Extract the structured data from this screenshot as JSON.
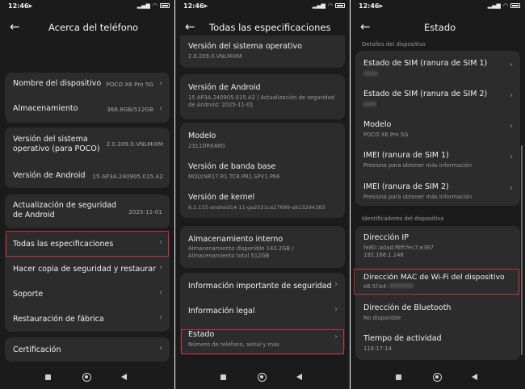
{
  "status": {
    "time": "12:46"
  },
  "screen1": {
    "title": "Acerca del teléfono",
    "device_name_label": "Nombre del dispositivo",
    "device_name_value": "POCO X6 Pro 5G",
    "storage_label": "Almacenamiento",
    "storage_value": "368.8GB/512GB",
    "os_version_label": "Versión del sistema operativo (para POCO)",
    "os_version_value": "2.0.209.0.VNLMIXM",
    "android_label": "Versión de Android",
    "android_value": "15 AP3A.240905.015.A2",
    "security_label": "Actualización de seguridad de Android",
    "security_value": "2025-11-01",
    "all_specs_label": "Todas las especificaciones",
    "backup_label": "Hacer copia de seguridad y restaurar",
    "support_label": "Soporte",
    "factory_label": "Restauración de fábrica",
    "cert_label": "Certificación"
  },
  "screen2": {
    "title": "Todas las especificaciones",
    "os_label": "Versión del sistema operativo",
    "os_value": "2.0.209.0.VNLMIXM",
    "android_label": "Versión de Android",
    "android_value": "15 AP3A.240905.015.A2 | Actualización de seguridad de Android: 2025-11-01",
    "model_label": "Modelo",
    "model_value": "2311DRK48G",
    "baseband_label": "Versión de banda base",
    "baseband_value": "MOLY.NR17.R1.TC8.PR1.SPV1.P66",
    "kernel_label": "Versión de kernel",
    "kernel_value": "6.1.115-android14-11-ga2521ca27699-ab13294383",
    "internal_storage_label": "Almacenamiento interno",
    "internal_storage_line1": "Almacenamiento disponible  143.2GB /",
    "internal_storage_line2": "Almacenamiento total  512GB",
    "safety_label": "Información importante de seguridad",
    "legal_label": "Información legal",
    "status_label": "Estado",
    "status_sub": "Número de teléfono, señal y más"
  },
  "screen3": {
    "title": "Estado",
    "section_device": "Detalles del dispositivo",
    "sim1_label": "Estado de SIM (ranura de SIM 1)",
    "sim2_label": "Estado de SIM (ranura de SIM 2)",
    "model_label": "Modelo",
    "model_value": "POCO X6 Pro 5G",
    "imei1_label": "IMEI (ranura de SIM 1)",
    "imei2_label": "IMEI (ranura de SIM 2)",
    "imei_sub": "Presiona para obtener más información",
    "section_ids": "Identificadores del dispositivo",
    "ip_label": "Dirección IP",
    "ip_line1": "fe80::a0ad:f6ff:fec7:e387",
    "ip_line2": "192.168.1.148",
    "mac_label": "Dirección MAC de Wi-Fi del dispositivo",
    "mac_value": "e8:5f:b4:",
    "bt_label": "Dirección de Bluetooth",
    "bt_value": "No disponible",
    "uptime_label": "Tiempo de actividad",
    "uptime_value": "116:17:14"
  },
  "icons": [
    "back-arrow-icon",
    "chevron-right-icon",
    "telegram-icon",
    "wifi-icon",
    "signal-icon",
    "battery-icon",
    "recents-icon",
    "home-icon",
    "back-nav-icon"
  ],
  "colors": {
    "background": "#1b1b1b",
    "card": "#2c2c2c",
    "highlight": "#c8323a"
  }
}
